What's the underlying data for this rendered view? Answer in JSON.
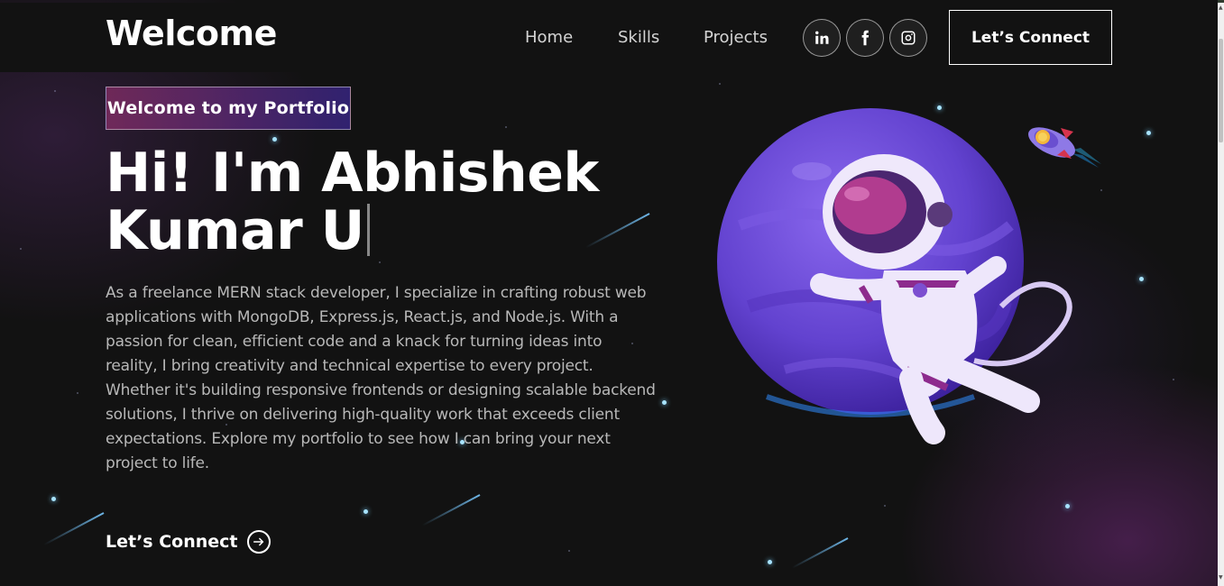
{
  "navbar": {
    "brand": "Welcome",
    "links": [
      "Home",
      "Skills",
      "Projects"
    ],
    "social": [
      "linkedin-icon",
      "facebook-icon",
      "instagram-icon"
    ],
    "cta_label": "Let’s Connect"
  },
  "hero": {
    "tagline": "Welcome to my Portfolio",
    "headline_line1": "Hi! I'm Abhishek",
    "headline_line2": "Kumar U",
    "description": "As a freelance MERN stack developer, I specialize in crafting robust web applications with MongoDB, Express.js, React.js, and Node.js. With a passion for clean, efficient code and a knack for turning ideas into reality, I bring creativity and technical expertise to every project. Whether it's building responsive frontends or designing scalable backend solutions, I thrive on delivering high-quality work that exceeds client expectations. Explore my portfolio to see how I can bring your next project to life.",
    "cta_label": "Let’s Connect",
    "cta_icon": "arrow-right-circle-icon"
  },
  "colors": {
    "background": "#121212",
    "tagline_gradient_start": "#aa367c",
    "tagline_gradient_end": "#4a2fbd",
    "planet": "#6a45d8",
    "star": "#a8e4ff"
  }
}
